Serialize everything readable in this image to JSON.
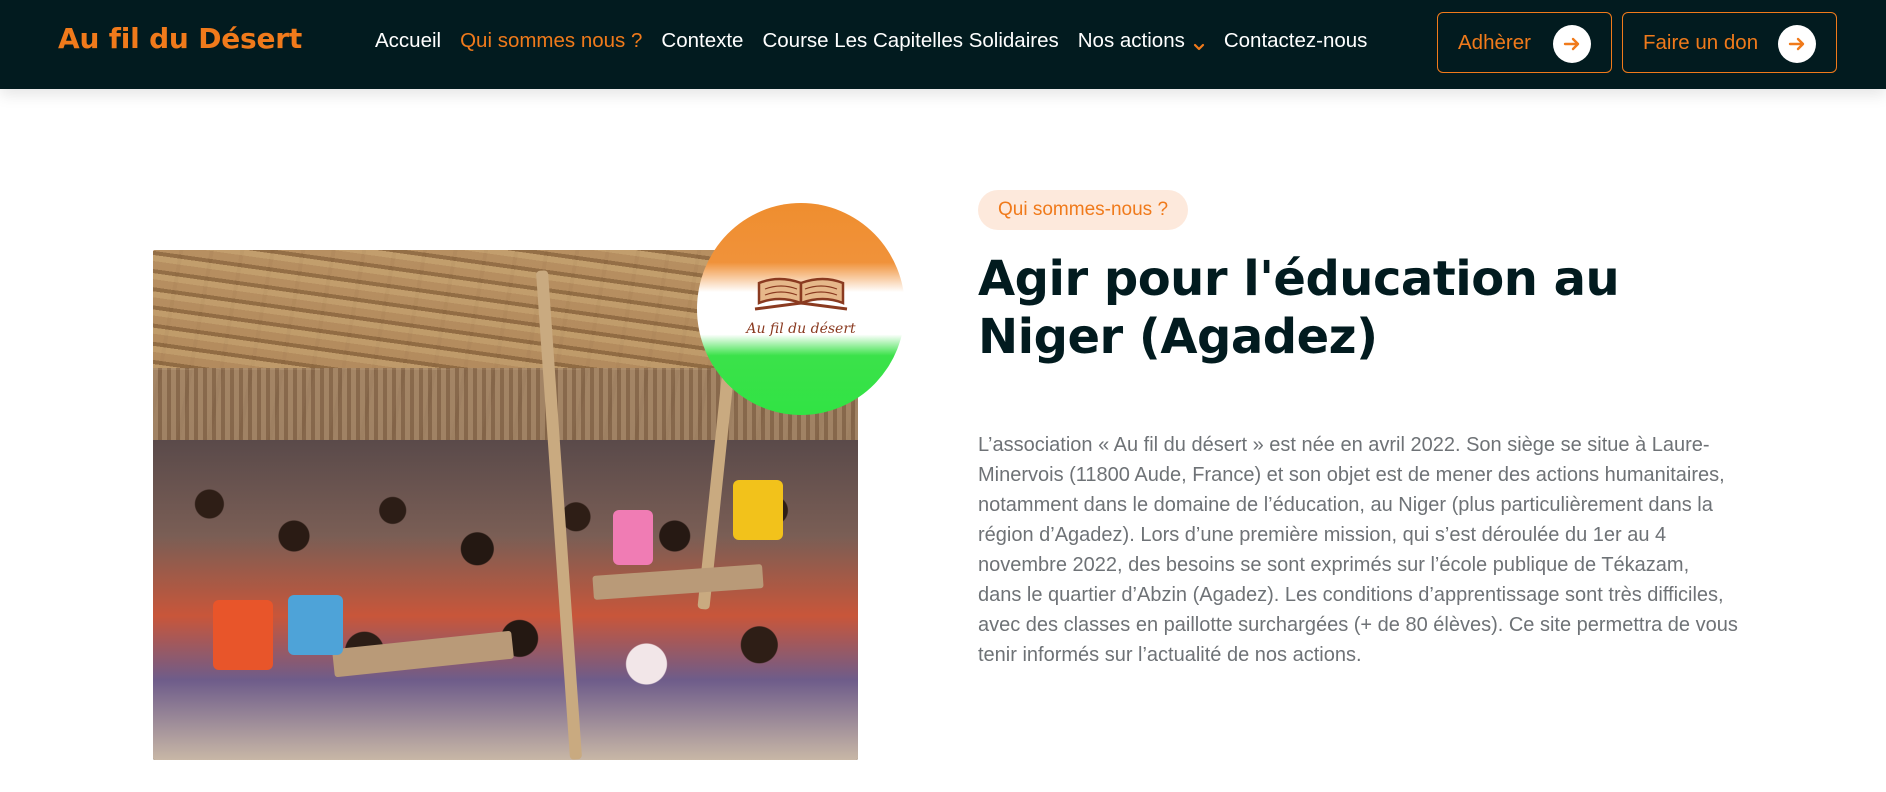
{
  "header": {
    "brand": "Au fil du Désert",
    "nav": [
      {
        "label": "Accueil",
        "active": false
      },
      {
        "label": "Qui sommes nous ?",
        "active": true
      },
      {
        "label": "Contexte",
        "active": false
      },
      {
        "label": "Course Les Capitelles Solidaires",
        "active": false
      },
      {
        "label": "Nos actions",
        "active": false,
        "has_dropdown": true
      },
      {
        "label": "Contactez-nous",
        "active": false
      }
    ],
    "buttons": {
      "adherer": "Adhèrer",
      "don": "Faire un don"
    }
  },
  "logo": {
    "script_text": "Au fil du désert"
  },
  "main": {
    "pill": "Qui sommes-nous ?",
    "title": "Agir pour l'éducation au Niger (Agadez)",
    "paragraph": "L’association « Au fil du désert » est née en avril 2022. Son siège se situe à Laure-Minervois (11800 Aude, France) et son objet est de mener des actions humanitaires, notamment dans le domaine de l’éducation, au Niger (plus particulièrement dans la région d’Agadez). Lors d’une première mission, qui s’est déroulée du 1er au 4 novembre 2022, des besoins se sont exprimés sur l’école publique de Tékazam, dans le quartier d’Abzin (Agadez). Les conditions d’apprentissage sont très difficiles, avec des classes en paillotte surchargées (+ de 80 élèves). Ce site permettra de vous tenir informés sur l’actualité de nos actions."
  },
  "colors": {
    "header_bg": "#021b1f",
    "accent": "#f07a1b",
    "pill_bg": "#fde9dc",
    "title": "#021b1f",
    "body_text": "#6e7276"
  },
  "icons": {
    "nav_dropdown": "chevron-down-icon",
    "button_arrow": "arrow-right-icon",
    "logo": "open-book-icon"
  }
}
